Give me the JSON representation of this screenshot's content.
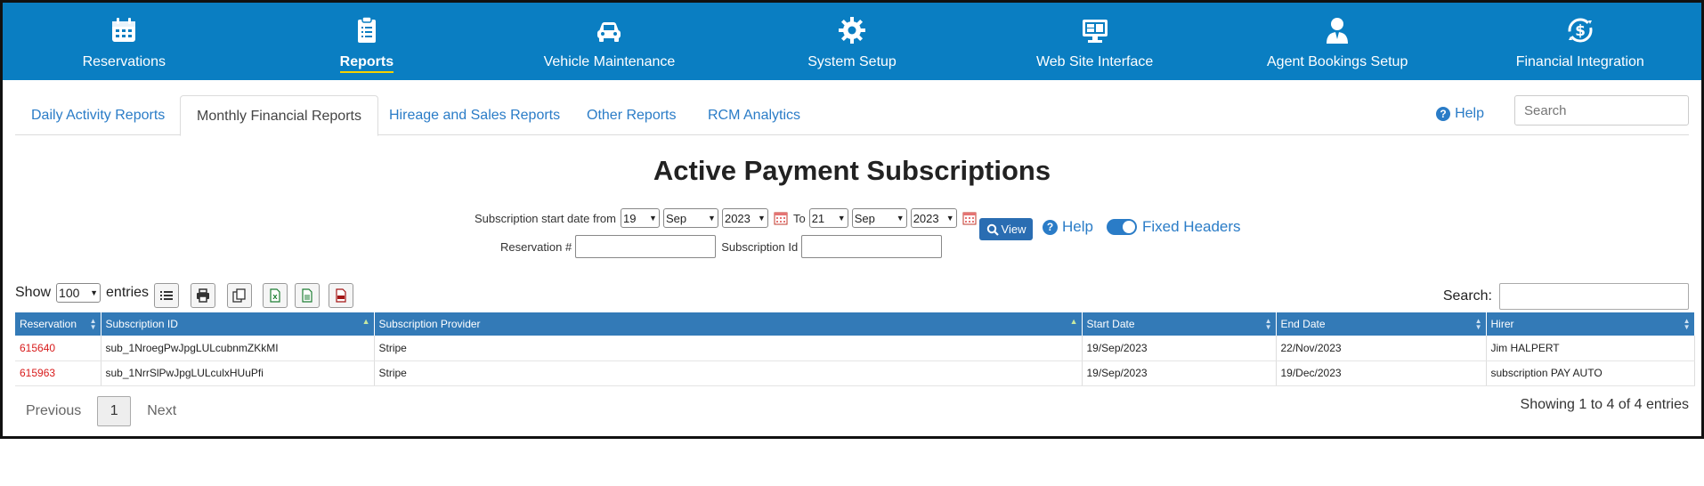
{
  "nav": {
    "items": [
      {
        "label": "Reservations",
        "icon": "calendar-icon",
        "active": false
      },
      {
        "label": "Reports",
        "icon": "clipboard-icon",
        "active": true
      },
      {
        "label": "Vehicle Maintenance",
        "icon": "car-icon",
        "active": false
      },
      {
        "label": "System Setup",
        "icon": "gear-icon",
        "active": false
      },
      {
        "label": "Web Site Interface",
        "icon": "monitor-icon",
        "active": false
      },
      {
        "label": "Agent Bookings Setup",
        "icon": "agent-icon",
        "active": false
      },
      {
        "label": "Financial Integration",
        "icon": "dollar-cycle-icon",
        "active": false
      }
    ]
  },
  "tabs": [
    {
      "label": "Daily Activity Reports",
      "active": false
    },
    {
      "label": "Monthly Financial Reports",
      "active": true
    },
    {
      "label": "Hireage and Sales Reports",
      "active": false
    },
    {
      "label": "Other Reports",
      "active": false
    },
    {
      "label": "RCM Analytics",
      "active": false
    }
  ],
  "header": {
    "help_label": "Help",
    "search_placeholder": "Search"
  },
  "page": {
    "title": "Active Payment Subscriptions"
  },
  "filter": {
    "start_label": "Subscription start date from",
    "from_day": "19",
    "from_month": "Sep",
    "from_year": "2023",
    "to_label": "To",
    "to_day": "21",
    "to_month": "Sep",
    "to_year": "2023",
    "reservation_label": "Reservation #",
    "reservation_value": "",
    "subscription_label": "Subscription Id",
    "subscription_value": "",
    "view_label": "View",
    "help_label": "Help",
    "fixed_headers_label": "Fixed Headers",
    "fixed_headers_on": true
  },
  "table_controls": {
    "show_label": "Show",
    "entries_value": "100",
    "entries_label": "entries",
    "search_label": "Search:"
  },
  "table": {
    "columns": [
      "Reservation",
      "Subscription ID",
      "Subscription Provider",
      "Start Date",
      "End Date",
      "Hirer"
    ],
    "rows": [
      [
        "615640",
        "sub_1NroegPwJpgLULcubnmZKkMI",
        "Stripe",
        "19/Sep/2023",
        "22/Nov/2023",
        "Jim HALPERT"
      ],
      [
        "615963",
        "sub_1NrrSlPwJpgLULculxHUuPfi",
        "Stripe",
        "19/Sep/2023",
        "19/Dec/2023",
        "subscription PAY AUTO"
      ]
    ]
  },
  "pagination": {
    "previous_label": "Previous",
    "current_page": "1",
    "next_label": "Next",
    "info": "Showing 1 to 4 of 4 entries"
  },
  "colors": {
    "nav_bg": "#0a7ec2",
    "table_header": "#337ab7",
    "link": "#2a7cc7",
    "reservation_red": "#d81b1b",
    "active_underline": "#f5d100"
  }
}
